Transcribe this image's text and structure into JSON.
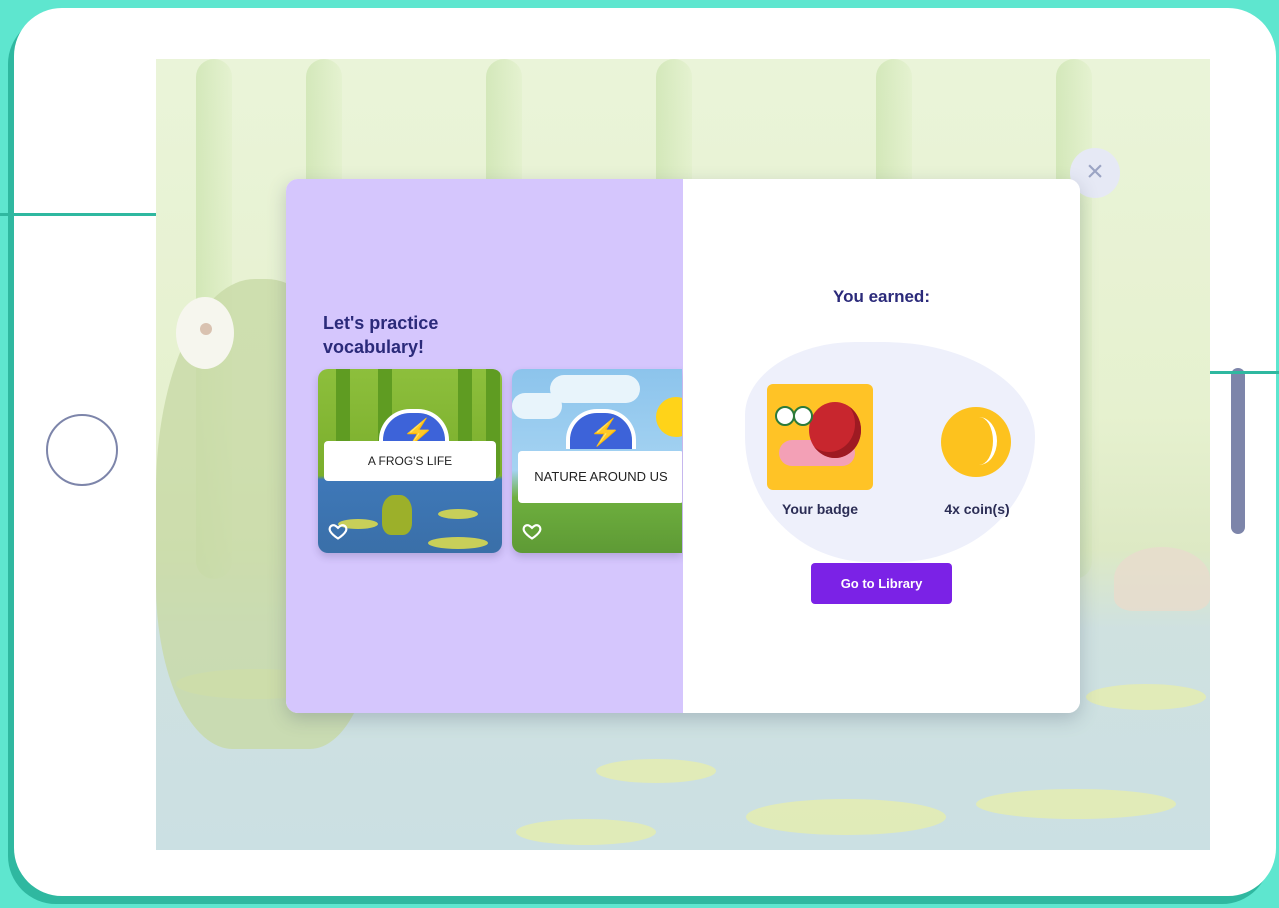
{
  "modal": {
    "close_icon": "×",
    "practice": {
      "title": "Let's practice vocabulary!",
      "cards": [
        {
          "label": "A FROG'S LIFE",
          "icon": "heart-icon"
        },
        {
          "label": "NATURE AROUND US",
          "icon": "heart-icon"
        }
      ]
    },
    "reward": {
      "title": "You earned:",
      "badge_label": "Your badge",
      "coin_label": "4x coin(s)",
      "button_label": "Go to Library"
    }
  },
  "colors": {
    "frame": "#5ee6cf",
    "left_panel": "#d5c6fd",
    "accent_button": "#7b22e6",
    "heading": "#2b2a7a",
    "coin": "#fdc21e"
  }
}
